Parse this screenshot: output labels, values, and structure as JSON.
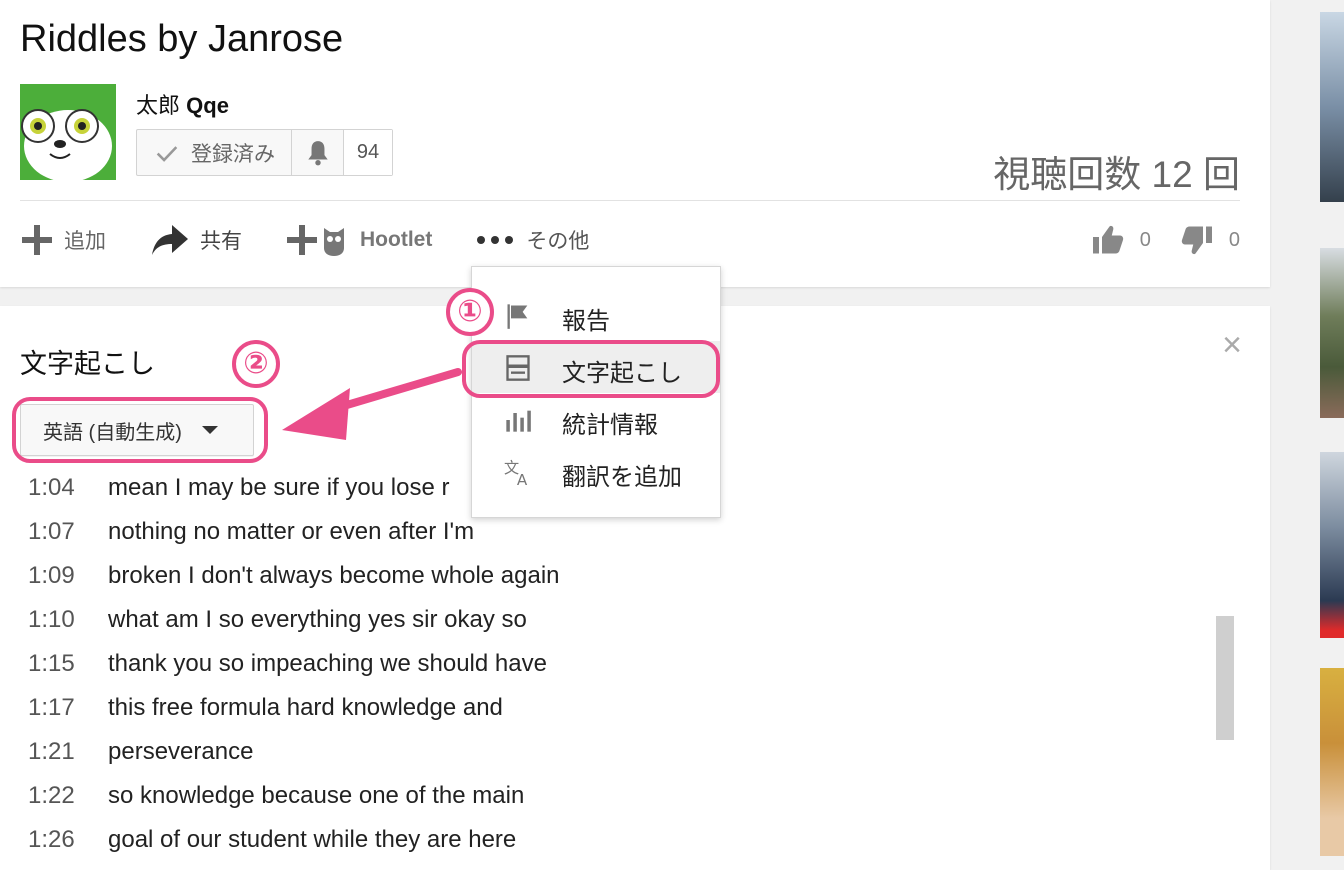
{
  "video": {
    "title": "Riddles by Janrose",
    "channel_prefix": "太郎",
    "channel_suffix": "Qqe",
    "subscribed_label": "登録済み",
    "subscriber_count": "94",
    "views": "視聴回数 12 回"
  },
  "actions": {
    "add": "追加",
    "share": "共有",
    "hootlet": "Hootlet",
    "more": "その他",
    "likes": "0",
    "dislikes": "0"
  },
  "menu": {
    "items": [
      {
        "label": "報告",
        "icon": "flag-icon"
      },
      {
        "label": "文字起こし",
        "icon": "transcript-icon"
      },
      {
        "label": "統計情報",
        "icon": "stats-icon"
      },
      {
        "label": "翻訳を追加",
        "icon": "translate-icon"
      }
    ]
  },
  "transcript": {
    "title": "文字起こし",
    "language": "英語 (自動生成)",
    "close": "×",
    "lines": [
      {
        "time": "1:04",
        "text": "mean I may be sure if you lose r"
      },
      {
        "time": "1:07",
        "text": "nothing no matter or even after I'm"
      },
      {
        "time": "1:09",
        "text": "broken I don't always become whole again"
      },
      {
        "time": "1:10",
        "text": "what am I so everything yes sir okay so"
      },
      {
        "time": "1:15",
        "text": "thank you so impeaching we should have"
      },
      {
        "time": "1:17",
        "text": "this free formula hard knowledge and"
      },
      {
        "time": "1:21",
        "text": "perseverance"
      },
      {
        "time": "1:22",
        "text": "so knowledge because one of the main"
      },
      {
        "time": "1:26",
        "text": "goal of our student while they are here"
      }
    ]
  },
  "annotations": {
    "marker_1": "①",
    "marker_2": "②"
  },
  "colors": {
    "highlight": "#ea4c89",
    "background": "#f1f1f1"
  }
}
